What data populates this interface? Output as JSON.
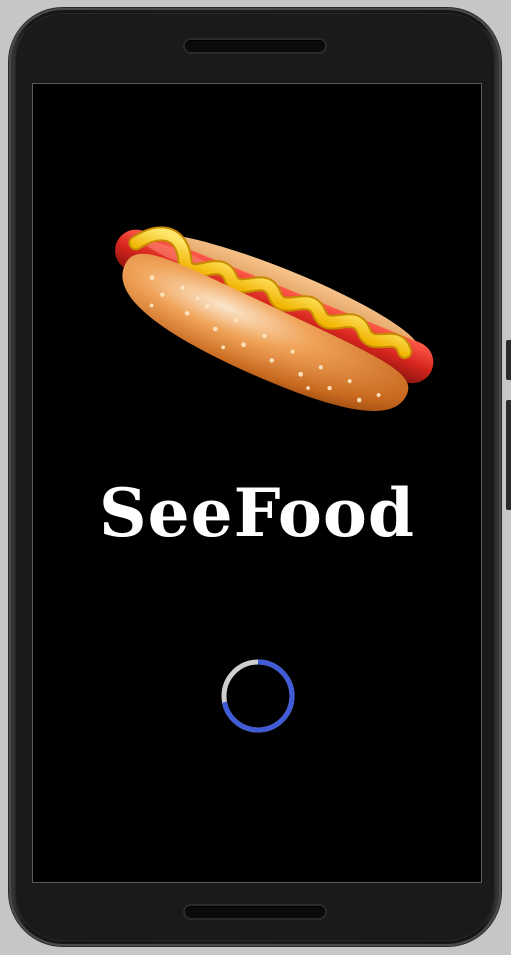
{
  "app": {
    "title": "SeeFood",
    "logo_icon": "hotdog-icon",
    "loading_indicator": "circular-progress"
  },
  "colors": {
    "screen_background": "#000000",
    "title_text": "#ffffff",
    "spinner_track": "#cfcfcf",
    "spinner_arc": "#3f5bd6"
  },
  "spinner": {
    "progress": 0.72
  }
}
